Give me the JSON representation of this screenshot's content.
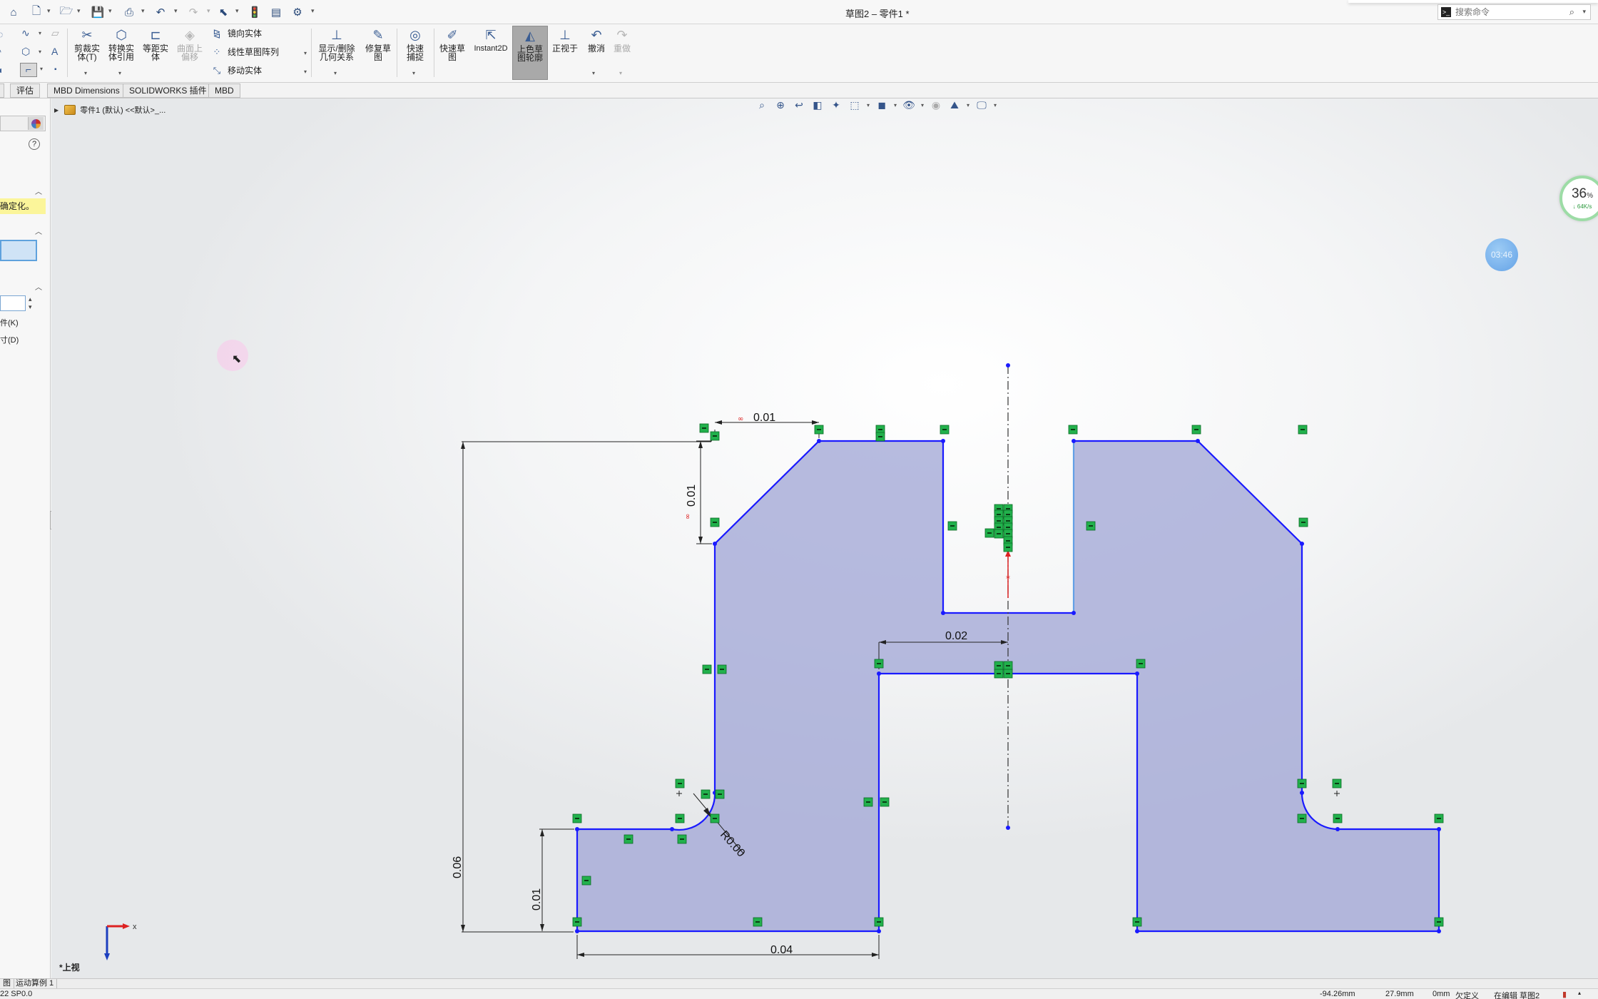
{
  "app": {
    "document_title": "草图2 – 零件1 *"
  },
  "search": {
    "placeholder": "搜索命令"
  },
  "ribbon": {
    "trim_label": "剪裁实体(T)",
    "convert_label": "转换实体引用",
    "offset_label": "等距实体",
    "offset_surface_label": "曲面上偏移",
    "mirror_label": "镜向实体",
    "linear_pattern_label": "线性草图阵列",
    "move_label": "移动实体",
    "relations_label": "显示/删除几何关系",
    "repair_label": "修复草图",
    "quick_snaps_label": "快速捕捉",
    "rapid_sketch_label": "快速草图",
    "instant2d_label": "Instant2D",
    "shaded_contours_label": "上色草图轮廓",
    "normal_to_label": "正视于",
    "undo_label": "撤消",
    "redo_label": "重做"
  },
  "tabs": [
    "评估",
    "MBD Dimensions",
    "SOLIDWORKS 插件",
    "MBD"
  ],
  "left_panel": {
    "message": "确定化。",
    "option_k": "件(K)",
    "option_d": "寸(D)",
    "help": "?"
  },
  "feature_tree": {
    "label": "零件1 (默认) <<默认>_..."
  },
  "dimensions": {
    "top_width": "0.01",
    "chamfer_height": "0.01",
    "slot_offset": "0.02",
    "fillet_radius": "R0.00",
    "total_height": "0.06",
    "foot_height": "0.01",
    "base_width": "0.04"
  },
  "triad": {
    "x_label": "x",
    "view_label": "*上视"
  },
  "network_widget": {
    "percent": "36",
    "percent_sign": "%",
    "speed": "↓ 64K/s"
  },
  "clock": "03:46",
  "bottom_tabs": [
    "图",
    "运动算例 1"
  ],
  "status": {
    "version": "22 SP0.0",
    "x_coord": "-94.26mm",
    "y_coord": "27.9mm",
    "z_coord": "0mm",
    "definition": "欠定义",
    "editing": "在编辑 草图2"
  },
  "colors": {
    "sketch_line": "#1a1aff",
    "sketch_fill": "#a3a8d6",
    "relation_badge": "#22b14c",
    "accent": "#3a5d93"
  }
}
